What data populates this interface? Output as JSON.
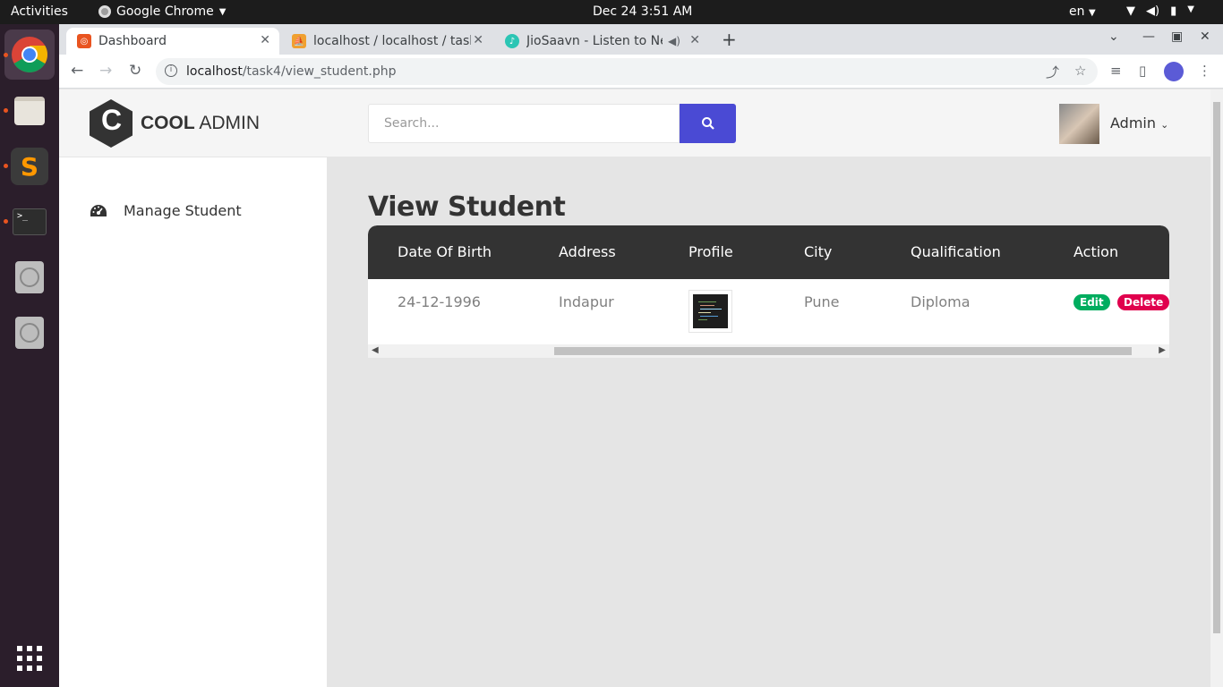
{
  "os": {
    "activities": "Activities",
    "app_name": "Google Chrome",
    "clock": "Dec 24  3:51 AM",
    "lang": "en"
  },
  "browser": {
    "tabs": [
      {
        "title": "Dashboard",
        "active": true
      },
      {
        "title": "localhost / localhost / task",
        "active": false
      },
      {
        "title": "JioSaavn - Listen to New",
        "active": false
      }
    ],
    "url_host": "localhost",
    "url_path": "/task4/view_student.php"
  },
  "brand": {
    "letter": "C",
    "name_bold": "COOL",
    "name_regular": " ADMIN"
  },
  "sidebar": {
    "items": [
      {
        "label": "Manage Student",
        "icon": "dashboard-gauge-icon"
      }
    ]
  },
  "header": {
    "search_placeholder": "Search...",
    "user_name": "Admin"
  },
  "main": {
    "title": "View Student",
    "table": {
      "columns": [
        "Date Of Birth",
        "Address",
        "Profile",
        "City",
        "Qualification",
        "Action"
      ],
      "rows": [
        {
          "dob": "24-12-1996",
          "address": "Indapur",
          "profile": "image-thumbnail",
          "city": "Pune",
          "qualification": "Diploma",
          "edit_label": "Edit",
          "delete_label": "Delete"
        }
      ]
    }
  },
  "colors": {
    "accent": "#4a4ad4",
    "table_header": "#333333",
    "edit": "#00ad5f",
    "delete": "#e0004d"
  }
}
